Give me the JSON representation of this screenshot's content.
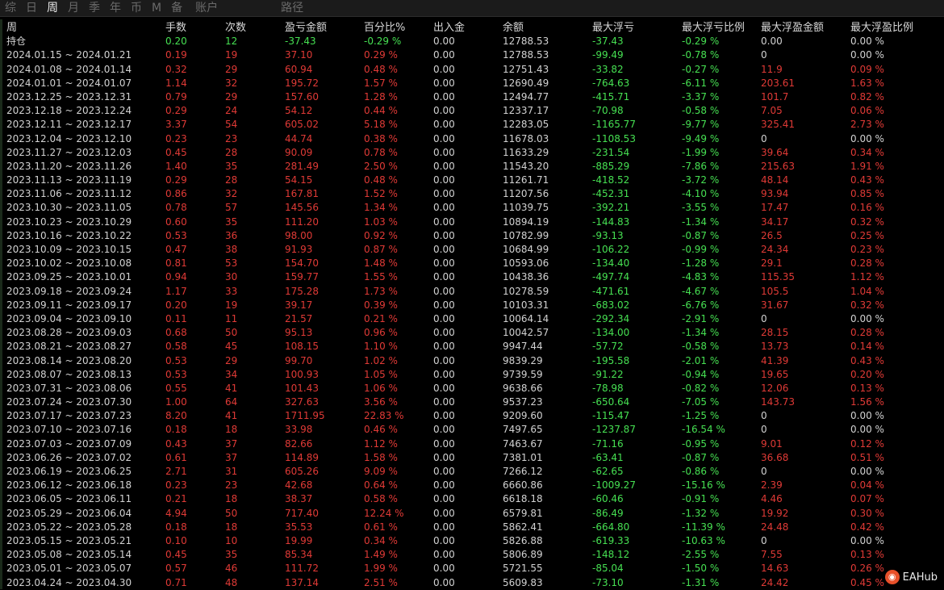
{
  "tabs": [
    {
      "label": "综",
      "active": false
    },
    {
      "label": "日",
      "active": false
    },
    {
      "label": "周",
      "active": true
    },
    {
      "label": "月",
      "active": false
    },
    {
      "label": "季",
      "active": false
    },
    {
      "label": "年",
      "active": false
    },
    {
      "label": "币",
      "active": false
    },
    {
      "label": "M",
      "active": false
    },
    {
      "label": "备",
      "active": false
    },
    {
      "label": "账户",
      "active": false
    },
    {
      "label": "路径",
      "active": false
    }
  ],
  "columns": [
    "周",
    "手数",
    "次数",
    "盈亏金额",
    "百分比%",
    "出入金",
    "余额",
    "最大浮亏",
    "最大浮亏比例",
    "最大浮盈金额",
    "最大浮盈比例"
  ],
  "colors": {
    "positive": "#e03a36",
    "negative": "#46e052",
    "neutral": "#d2d2d2",
    "active_tab": "#e8e8e8"
  },
  "rows": [
    [
      "持仓",
      "0.20",
      "12",
      "-37.43",
      "-0.29 %",
      "0.00",
      "12788.53",
      "-37.43",
      "-0.29 %",
      "0.00",
      "0.00 %"
    ],
    [
      "2024.01.15 ~ 2024.01.21",
      "0.19",
      "19",
      "37.10",
      "0.29 %",
      "0.00",
      "12788.53",
      "-99.49",
      "-0.78 %",
      "0",
      "0.00 %"
    ],
    [
      "2024.01.08 ~ 2024.01.14",
      "0.32",
      "29",
      "60.94",
      "0.48 %",
      "0.00",
      "12751.43",
      "-33.82",
      "-0.27 %",
      "11.9",
      "0.09 %"
    ],
    [
      "2024.01.01 ~ 2024.01.07",
      "1.14",
      "32",
      "195.72",
      "1.57 %",
      "0.00",
      "12690.49",
      "-764.63",
      "-6.11 %",
      "203.61",
      "1.63 %"
    ],
    [
      "2023.12.25 ~ 2023.12.31",
      "0.79",
      "29",
      "157.60",
      "1.28 %",
      "0.00",
      "12494.77",
      "-415.71",
      "-3.37 %",
      "101.7",
      "0.82 %"
    ],
    [
      "2023.12.18 ~ 2023.12.24",
      "0.29",
      "24",
      "54.12",
      "0.44 %",
      "0.00",
      "12337.17",
      "-70.98",
      "-0.58 %",
      "7.05",
      "0.06 %"
    ],
    [
      "2023.12.11 ~ 2023.12.17",
      "3.37",
      "54",
      "605.02",
      "5.18 %",
      "0.00",
      "12283.05",
      "-1165.77",
      "-9.77 %",
      "325.41",
      "2.73 %"
    ],
    [
      "2023.12.04 ~ 2023.12.10",
      "0.23",
      "23",
      "44.74",
      "0.38 %",
      "0.00",
      "11678.03",
      "-1108.53",
      "-9.49 %",
      "0",
      "0.00 %"
    ],
    [
      "2023.11.27 ~ 2023.12.03",
      "0.45",
      "28",
      "90.09",
      "0.78 %",
      "0.00",
      "11633.29",
      "-231.54",
      "-1.99 %",
      "39.64",
      "0.34 %"
    ],
    [
      "2023.11.20 ~ 2023.11.26",
      "1.40",
      "35",
      "281.49",
      "2.50 %",
      "0.00",
      "11543.20",
      "-885.29",
      "-7.86 %",
      "215.63",
      "1.91 %"
    ],
    [
      "2023.11.13 ~ 2023.11.19",
      "0.29",
      "28",
      "54.15",
      "0.48 %",
      "0.00",
      "11261.71",
      "-418.52",
      "-3.72 %",
      "48.14",
      "0.43 %"
    ],
    [
      "2023.11.06 ~ 2023.11.12",
      "0.86",
      "32",
      "167.81",
      "1.52 %",
      "0.00",
      "11207.56",
      "-452.31",
      "-4.10 %",
      "93.94",
      "0.85 %"
    ],
    [
      "2023.10.30 ~ 2023.11.05",
      "0.78",
      "57",
      "145.56",
      "1.34 %",
      "0.00",
      "11039.75",
      "-392.21",
      "-3.55 %",
      "17.47",
      "0.16 %"
    ],
    [
      "2023.10.23 ~ 2023.10.29",
      "0.60",
      "35",
      "111.20",
      "1.03 %",
      "0.00",
      "10894.19",
      "-144.83",
      "-1.34 %",
      "34.17",
      "0.32 %"
    ],
    [
      "2023.10.16 ~ 2023.10.22",
      "0.53",
      "36",
      "98.00",
      "0.92 %",
      "0.00",
      "10782.99",
      "-93.13",
      "-0.87 %",
      "26.5",
      "0.25 %"
    ],
    [
      "2023.10.09 ~ 2023.10.15",
      "0.47",
      "38",
      "91.93",
      "0.87 %",
      "0.00",
      "10684.99",
      "-106.22",
      "-0.99 %",
      "24.34",
      "0.23 %"
    ],
    [
      "2023.10.02 ~ 2023.10.08",
      "0.81",
      "53",
      "154.70",
      "1.48 %",
      "0.00",
      "10593.06",
      "-134.40",
      "-1.28 %",
      "29.1",
      "0.28 %"
    ],
    [
      "2023.09.25 ~ 2023.10.01",
      "0.94",
      "30",
      "159.77",
      "1.55 %",
      "0.00",
      "10438.36",
      "-497.74",
      "-4.83 %",
      "115.35",
      "1.12 %"
    ],
    [
      "2023.09.18 ~ 2023.09.24",
      "1.17",
      "33",
      "175.28",
      "1.73 %",
      "0.00",
      "10278.59",
      "-471.61",
      "-4.67 %",
      "105.5",
      "1.04 %"
    ],
    [
      "2023.09.11 ~ 2023.09.17",
      "0.20",
      "19",
      "39.17",
      "0.39 %",
      "0.00",
      "10103.31",
      "-683.02",
      "-6.76 %",
      "31.67",
      "0.32 %"
    ],
    [
      "2023.09.04 ~ 2023.09.10",
      "0.11",
      "11",
      "21.57",
      "0.21 %",
      "0.00",
      "10064.14",
      "-292.34",
      "-2.91 %",
      "0",
      "0.00 %"
    ],
    [
      "2023.08.28 ~ 2023.09.03",
      "0.68",
      "50",
      "95.13",
      "0.96 %",
      "0.00",
      "10042.57",
      "-134.00",
      "-1.34 %",
      "28.15",
      "0.28 %"
    ],
    [
      "2023.08.21 ~ 2023.08.27",
      "0.58",
      "45",
      "108.15",
      "1.10 %",
      "0.00",
      "9947.44",
      "-57.72",
      "-0.58 %",
      "13.73",
      "0.14 %"
    ],
    [
      "2023.08.14 ~ 2023.08.20",
      "0.53",
      "29",
      "99.70",
      "1.02 %",
      "0.00",
      "9839.29",
      "-195.58",
      "-2.01 %",
      "41.39",
      "0.43 %"
    ],
    [
      "2023.08.07 ~ 2023.08.13",
      "0.53",
      "34",
      "100.93",
      "1.05 %",
      "0.00",
      "9739.59",
      "-91.22",
      "-0.94 %",
      "19.65",
      "0.20 %"
    ],
    [
      "2023.07.31 ~ 2023.08.06",
      "0.55",
      "41",
      "101.43",
      "1.06 %",
      "0.00",
      "9638.66",
      "-78.98",
      "-0.82 %",
      "12.06",
      "0.13 %"
    ],
    [
      "2023.07.24 ~ 2023.07.30",
      "1.00",
      "64",
      "327.63",
      "3.56 %",
      "0.00",
      "9537.23",
      "-650.64",
      "-7.05 %",
      "143.73",
      "1.56 %"
    ],
    [
      "2023.07.17 ~ 2023.07.23",
      "8.20",
      "41",
      "1711.95",
      "22.83 %",
      "0.00",
      "9209.60",
      "-115.47",
      "-1.25 %",
      "0",
      "0.00 %"
    ],
    [
      "2023.07.10 ~ 2023.07.16",
      "0.18",
      "18",
      "33.98",
      "0.46 %",
      "0.00",
      "7497.65",
      "-1237.87",
      "-16.54 %",
      "0",
      "0.00 %"
    ],
    [
      "2023.07.03 ~ 2023.07.09",
      "0.43",
      "37",
      "82.66",
      "1.12 %",
      "0.00",
      "7463.67",
      "-71.16",
      "-0.95 %",
      "9.01",
      "0.12 %"
    ],
    [
      "2023.06.26 ~ 2023.07.02",
      "0.61",
      "37",
      "114.89",
      "1.58 %",
      "0.00",
      "7381.01",
      "-63.41",
      "-0.87 %",
      "36.68",
      "0.51 %"
    ],
    [
      "2023.06.19 ~ 2023.06.25",
      "2.71",
      "31",
      "605.26",
      "9.09 %",
      "0.00",
      "7266.12",
      "-62.65",
      "-0.86 %",
      "0",
      "0.00 %"
    ],
    [
      "2023.06.12 ~ 2023.06.18",
      "0.23",
      "23",
      "42.68",
      "0.64 %",
      "0.00",
      "6660.86",
      "-1009.27",
      "-15.16 %",
      "2.39",
      "0.04 %"
    ],
    [
      "2023.06.05 ~ 2023.06.11",
      "0.21",
      "18",
      "38.37",
      "0.58 %",
      "0.00",
      "6618.18",
      "-60.46",
      "-0.91 %",
      "4.46",
      "0.07 %"
    ],
    [
      "2023.05.29 ~ 2023.06.04",
      "4.94",
      "50",
      "717.40",
      "12.24 %",
      "0.00",
      "6579.81",
      "-86.49",
      "-1.32 %",
      "19.92",
      "0.30 %"
    ],
    [
      "2023.05.22 ~ 2023.05.28",
      "0.18",
      "18",
      "35.53",
      "0.61 %",
      "0.00",
      "5862.41",
      "-664.80",
      "-11.39 %",
      "24.48",
      "0.42 %"
    ],
    [
      "2023.05.15 ~ 2023.05.21",
      "0.10",
      "10",
      "19.99",
      "0.34 %",
      "0.00",
      "5826.88",
      "-619.33",
      "-10.63 %",
      "0",
      "0.00 %"
    ],
    [
      "2023.05.08 ~ 2023.05.14",
      "0.45",
      "35",
      "85.34",
      "1.49 %",
      "0.00",
      "5806.89",
      "-148.12",
      "-2.55 %",
      "7.55",
      "0.13 %"
    ],
    [
      "2023.05.01 ~ 2023.05.07",
      "0.57",
      "46",
      "111.72",
      "1.99 %",
      "0.00",
      "5721.55",
      "-85.04",
      "-1.50 %",
      "14.63",
      "0.26 %"
    ],
    [
      "2023.04.24 ~ 2023.04.30",
      "0.71",
      "48",
      "137.14",
      "2.51 %",
      "0.00",
      "5609.83",
      "-73.10",
      "-1.31 %",
      "24.42",
      "0.45 %"
    ]
  ],
  "watermark": {
    "text": "EAHub"
  }
}
